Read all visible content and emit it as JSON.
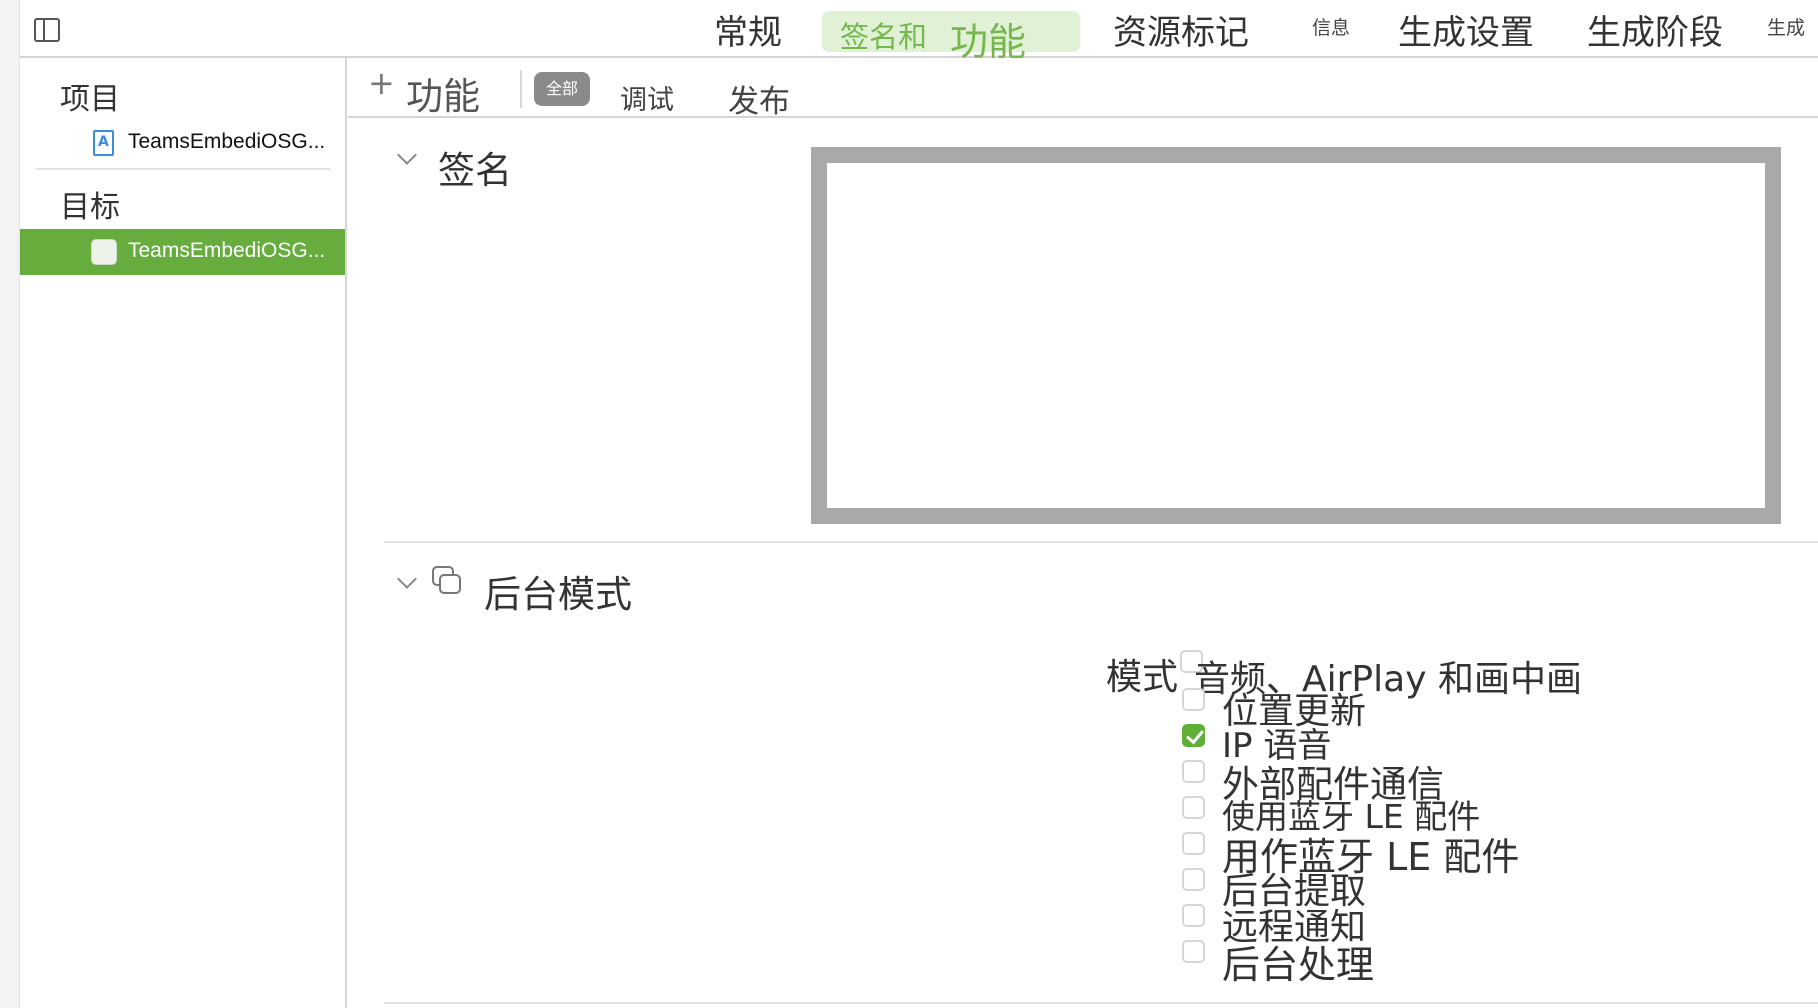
{
  "top_tabs": {
    "general": "常规",
    "signing_part1": "签名和",
    "signing_part2": "功能",
    "resource_tags": "资源标记",
    "info": "信息",
    "build_settings": "生成设置",
    "build_phases": "生成阶段",
    "build_rules": "生成"
  },
  "sidebar": {
    "project_heading": "项目",
    "project_item": "TeamsEmbediOSG...",
    "targets_heading": "目标",
    "target_item": "TeamsEmbediOSG..."
  },
  "capability_bar": {
    "add_symbol": "+",
    "add_label": "功能",
    "filter_all": "全部",
    "filter_debug": "调试",
    "filter_release": "发布"
  },
  "signing_section": {
    "title": "签名"
  },
  "background_modes": {
    "title": "后台模式",
    "modes_label": "模式",
    "options": [
      {
        "label": "音频、AirPlay 和画中画",
        "checked": false
      },
      {
        "label": "位置更新",
        "checked": false
      },
      {
        "label": "IP 语音",
        "checked": true
      },
      {
        "label": "外部配件通信",
        "checked": false
      },
      {
        "label": "使用蓝牙 LE 配件",
        "checked": false
      },
      {
        "label": "用作蓝牙 LE 配件",
        "checked": false
      },
      {
        "label": "后台提取",
        "checked": false
      },
      {
        "label": "远程通知",
        "checked": false
      },
      {
        "label": "后台处理",
        "checked": false
      }
    ]
  },
  "colors": {
    "accent_green": "#66ad3d",
    "selected_tab_bg": "#e1f1d5",
    "selected_tab_text": "#74b84d"
  }
}
